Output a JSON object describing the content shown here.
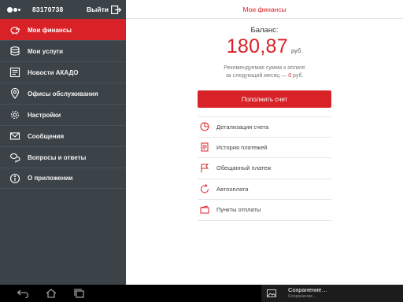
{
  "sidebar": {
    "account_number": "83170738",
    "logout_label": "Выйти",
    "items": [
      {
        "label": "Мои финансы",
        "icon": "piggy-bank-icon",
        "active": true
      },
      {
        "label": "Мои услуги",
        "icon": "stack-icon",
        "active": false
      },
      {
        "label": "Новости АКАДО",
        "icon": "newspaper-icon",
        "active": false
      },
      {
        "label": "Офисы обслуживания",
        "icon": "map-pin-icon",
        "active": false
      },
      {
        "label": "Настройки",
        "icon": "gear-icon",
        "active": false
      },
      {
        "label": "Сообщения",
        "icon": "envelope-icon",
        "active": false
      },
      {
        "label": "Вопросы и ответы",
        "icon": "chat-bubbles-icon",
        "active": false
      },
      {
        "label": "О приложении",
        "icon": "info-icon",
        "active": false
      }
    ]
  },
  "main": {
    "title": "Мои финансы",
    "balance_label": "Баланс:",
    "balance_amount": "180,87",
    "balance_currency": "руб.",
    "recommend_line1": "Рекомендуемая сумма к оплате",
    "recommend_prefix": "за следующий месяц — ",
    "recommend_amount": "0",
    "recommend_suffix": " руб.",
    "pay_button": "Пополнить счет",
    "menu": [
      {
        "label": "Детализация счета",
        "icon": "pie-chart-icon"
      },
      {
        "label": "История платежей",
        "icon": "document-icon"
      },
      {
        "label": "Обещанный платеж",
        "icon": "flag-icon"
      },
      {
        "label": "Автооплата",
        "icon": "refresh-icon"
      },
      {
        "label": "Пункты отплаты",
        "icon": "wallet-icon"
      }
    ]
  },
  "notification": {
    "title": "Сохранение…",
    "subtitle": "Сохранение…"
  },
  "colors": {
    "accent": "#d92128",
    "sidebar_bg": "#3b4248",
    "system_bar": "#000000"
  }
}
